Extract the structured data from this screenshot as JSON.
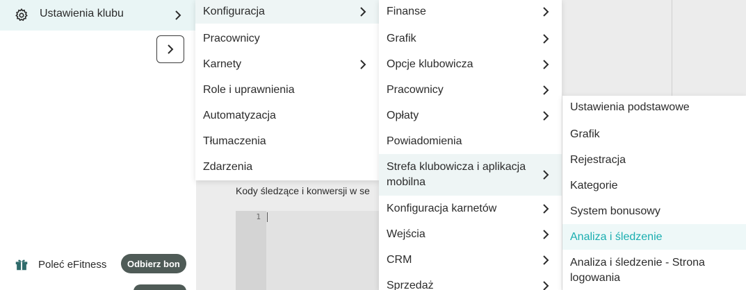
{
  "sidebar": {
    "active_item": {
      "label": "Ustawienia klubu",
      "icon": "gear-icon"
    },
    "collapse_button_icon": "chevron-right-icon",
    "refer": {
      "label": "Poleć eFitness",
      "badge": "Odbierz bon",
      "icon": "gift-icon"
    }
  },
  "main": {
    "codes_label": "Kody śledzące i konwersji w se",
    "editor_line": "1"
  },
  "menu_level1": {
    "items": [
      {
        "label": "Konfiguracja",
        "has_submenu": true,
        "highlighted": true
      },
      {
        "label": "Pracownicy",
        "has_submenu": false
      },
      {
        "label": "Karnety",
        "has_submenu": true
      },
      {
        "label": "Role i uprawnienia",
        "has_submenu": false
      },
      {
        "label": "Automatyzacja",
        "has_submenu": false
      },
      {
        "label": "Tłumaczenia",
        "has_submenu": false
      },
      {
        "label": "Zdarzenia",
        "has_submenu": false
      }
    ]
  },
  "menu_level2": {
    "items": [
      {
        "label": "Finanse",
        "has_submenu": true
      },
      {
        "label": "Grafik",
        "has_submenu": true
      },
      {
        "label": "Opcje klubowicza",
        "has_submenu": true
      },
      {
        "label": "Pracownicy",
        "has_submenu": true
      },
      {
        "label": "Opłaty",
        "has_submenu": true
      },
      {
        "label": "Powiadomienia",
        "has_submenu": false
      },
      {
        "label": "Strefa klubowicza i aplikacja mobilna",
        "has_submenu": true,
        "highlighted": true
      },
      {
        "label": "Konfiguracja karnetów",
        "has_submenu": true
      },
      {
        "label": "Wejścia",
        "has_submenu": true
      },
      {
        "label": "CRM",
        "has_submenu": true
      },
      {
        "label": "Sprzedaż",
        "has_submenu": true
      }
    ]
  },
  "menu_level3": {
    "items": [
      {
        "label": "Ustawienia podstawowe"
      },
      {
        "label": "Grafik"
      },
      {
        "label": "Rejestracja"
      },
      {
        "label": "Kategorie"
      },
      {
        "label": "System bonusowy"
      },
      {
        "label": "Analiza i śledzenie",
        "selected": true
      },
      {
        "label": "Analiza i śledzenie - Strona logowania"
      }
    ]
  },
  "colors": {
    "accent": "#1aaeb0",
    "highlight_bg": "#eef5f5",
    "badge_bg": "#4f5b57"
  }
}
